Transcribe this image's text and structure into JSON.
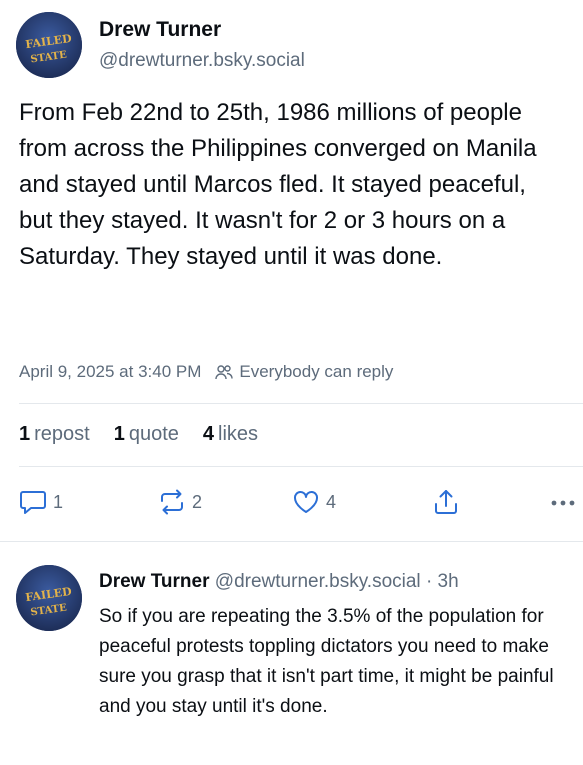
{
  "post": {
    "author_name": "Drew Turner",
    "author_handle": "@drewturner.bsky.social",
    "avatar_text_top": "FAILED",
    "avatar_text_bottom": "STATE",
    "text": "From Feb 22nd to 25th, 1986 millions of people from across the Philippines converged on Manila and stayed until Marcos fled. It stayed peaceful, but they stayed. It wasn't for 2 or 3 hours on a Saturday. They stayed until it was done.",
    "timestamp": "April 9, 2025 at 3:40 PM",
    "reply_setting": "Everybody can reply",
    "stats": {
      "reposts_count": "1",
      "reposts_label": "repost",
      "quotes_count": "1",
      "quotes_label": "quote",
      "likes_count": "4",
      "likes_label": "likes"
    },
    "actions": {
      "reply_count": "1",
      "repost_count": "2",
      "like_count": "4",
      "reply_icon": "reply-icon",
      "repost_icon": "repost-icon",
      "like_icon": "heart-icon",
      "share_icon": "share-icon",
      "more_icon": "more-icon"
    }
  },
  "reply": {
    "author_name": "Drew Turner",
    "author_handle": "@drewturner.bsky.social",
    "separator": "·",
    "time_ago": "3h",
    "text": "So if you are repeating the 3.5% of the population for peaceful protests toppling dictators you need to make sure you grasp that it isn't part time, it might be painful and you stay until it's done."
  },
  "colors": {
    "text": "#0b0f14",
    "muted": "#5d6b7b",
    "icon_blue": "#2c6fd6",
    "divider": "#e4e8ec",
    "avatar_bg": "#2b3f73",
    "avatar_text": "#e3b34a"
  }
}
